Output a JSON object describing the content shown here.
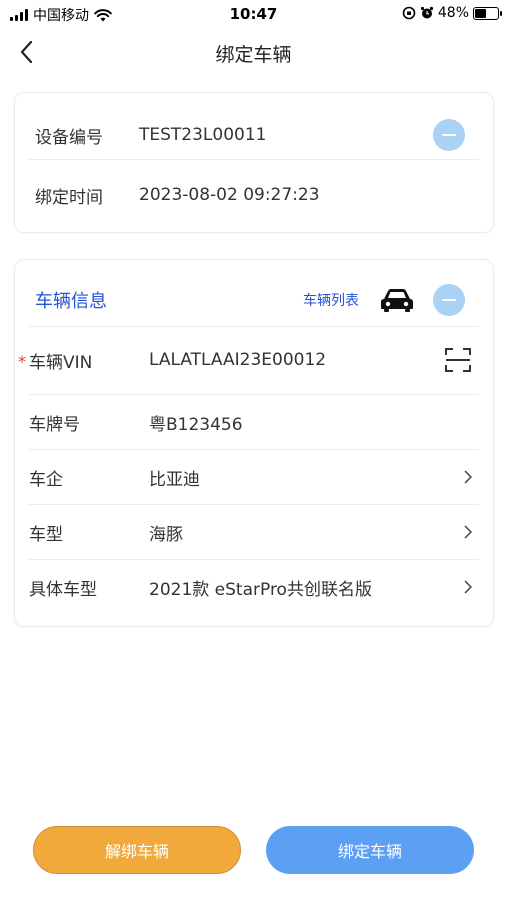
{
  "status_bar": {
    "carrier": "中国移动",
    "time": "10:47",
    "battery_text": "48%",
    "battery_level": 0.48
  },
  "nav": {
    "title": "绑定车辆"
  },
  "device_card": {
    "device_no_label": "设备编号",
    "device_no_value": "TEST23L00011",
    "bind_time_label": "绑定时间",
    "bind_time_value": "2023-08-02 09:27:23"
  },
  "vehicle_card": {
    "section_title": "车辆信息",
    "list_link": "车辆列表",
    "required_mark": "*",
    "rows": [
      {
        "label": "车辆VIN",
        "value": "LALATLAAI23E00012"
      },
      {
        "label": "车牌号",
        "value": "粤B123456"
      },
      {
        "label": "车企",
        "value": "比亚迪"
      },
      {
        "label": "车型",
        "value": "海豚"
      },
      {
        "label": "具体车型",
        "value": "2021款 eStarPro共创联名版"
      }
    ]
  },
  "buttons": {
    "unbind": "解绑车辆",
    "bind": "绑定车辆"
  },
  "colors": {
    "accent_blue": "#2553d6",
    "minus_bg": "#a9d2f4",
    "unbind_bg": "#f2a93b",
    "bind_bg": "#5ba0f2",
    "required": "#e04040"
  },
  "icons": [
    "signal-icon",
    "wifi-icon",
    "lock-rotation-icon",
    "alarm-icon",
    "battery-icon",
    "back-arrow-icon",
    "minus-circle-icon",
    "car-icon",
    "scan-icon",
    "chevron-right-icon"
  ]
}
